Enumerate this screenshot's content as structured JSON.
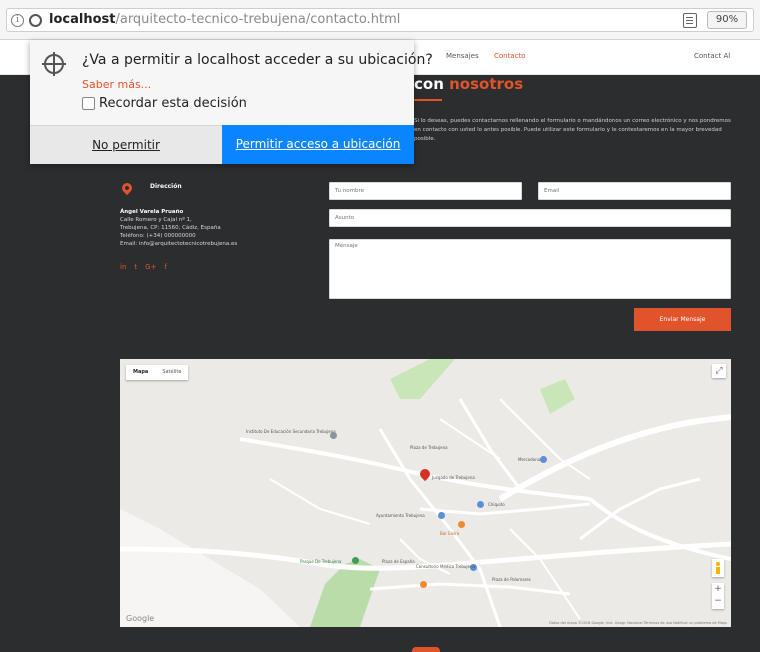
{
  "browser": {
    "url_host": "localhost",
    "url_path": "/arquitecto-tecnico-trebujena/contacto.html",
    "zoom": "90%"
  },
  "permission_popup": {
    "question": "¿Va a permitir a localhost acceder a su ubicación?",
    "learn_more": "Saber más...",
    "remember": "Recordar esta decisión",
    "deny": "No permitir",
    "allow": "Permitir acceso a ubicación"
  },
  "nav": {
    "items": [
      "Mensajes",
      "Contacto",
      "Contact Al"
    ]
  },
  "contact": {
    "heading_part1": "con ",
    "heading_part2": "nosotros",
    "intro": "Si lo deseas, puedes contactarnos rellenando el formulario o mandándonos un correo electrónico y nos pondremos en contacto con usted lo antes posible. Puede utilizar este formulario y le contestaremos en la mayor brevedad posible.",
    "address_label": "Dirección",
    "name": "Ángel Varela Pruaño",
    "address_lines": [
      "Calle Romero y Cajal nº 1,",
      "Trebujena, CP: 11560, Cádiz, España",
      "Teléfono: (+34) 000000000",
      "Email: info@arquitectotecnicotrebujena.es"
    ],
    "socials": [
      "in",
      "t",
      "G+",
      "f"
    ]
  },
  "form": {
    "name_placeholder": "Tu nombre",
    "email_placeholder": "Email",
    "subject_placeholder": "Asunto",
    "message_placeholder": "Mensaje",
    "send": "Enviar Mensaje"
  },
  "map": {
    "type_map": "Mapa",
    "type_satellite": "Satélite",
    "google": "Google",
    "footer": "Datos del mapa ©2018 Google, Inst. Geogr. Nacional    Términos de uso    Notificar un problema de Maps",
    "labels": {
      "a": "Instituto De Educación Secundaria Trebujena",
      "b": "Plaza de Trebujena",
      "c": "Juzgado de Trebujena",
      "d": "Mercadona",
      "e": "Ayuntamiento Trebujena",
      "f": "Bar Elvira",
      "g": "Parque De Trebujena",
      "h": "Plaza de España",
      "i": "Consultorio Médico Trebujena",
      "j": "Plaza de Palomares",
      "k": "Chiquito"
    }
  }
}
